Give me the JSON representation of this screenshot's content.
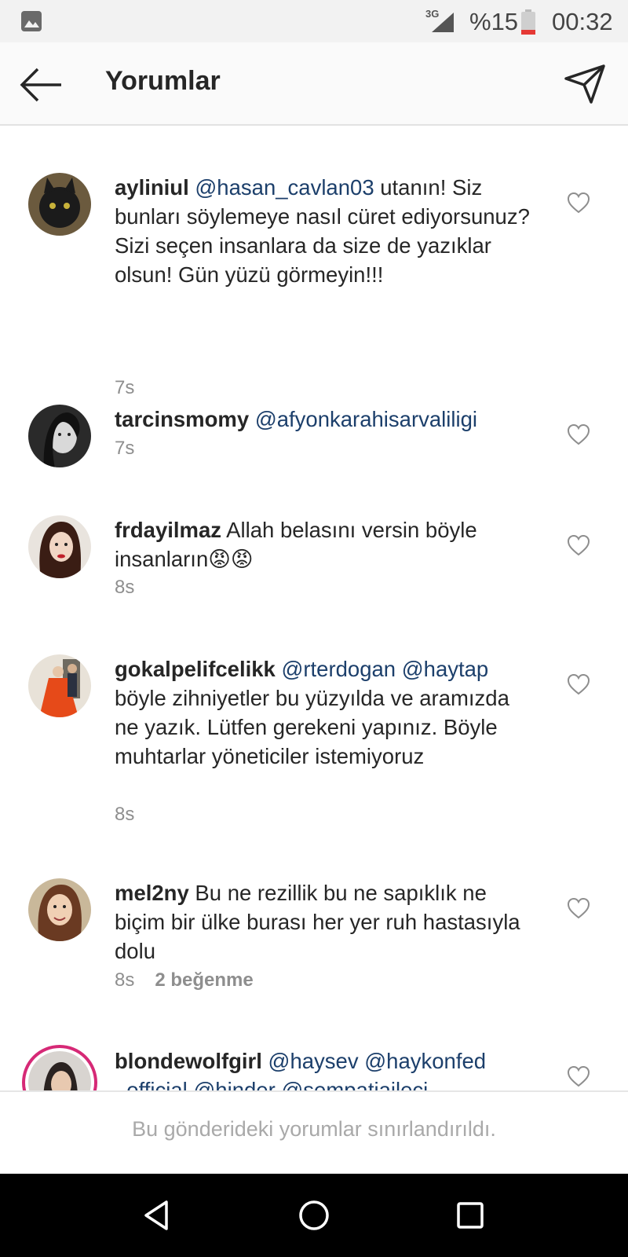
{
  "status_bar": {
    "network": "3G",
    "battery": "%15",
    "time": "00:32"
  },
  "header": {
    "title": "Yorumlar"
  },
  "comments": [
    {
      "username": "ayliniul",
      "mention": "@hasan_cavlan03",
      "text": " utanın! Siz bunları söylemeye nasıl cüret ediyorsunuz? Sizi seçen insanlara da size de yazıklar olsun! Gün yüzü görmeyin!!!",
      "time": "7s",
      "avatar": "black-cat"
    },
    {
      "username": "tarcinsmomy",
      "mention": "@afyonkarahisarvaliligi",
      "text": "",
      "time": "7s",
      "avatar": "woman-bw"
    },
    {
      "username": "frdayilmaz",
      "mention": "",
      "text": " Allah belasını versin böyle insanların😡😡",
      "time": "8s",
      "avatar": "woman-red-lips"
    },
    {
      "username": "gokalpelifcelikk",
      "mention": "@rterdogan @haytap",
      "text": " böyle zihniyetler bu yüzyılda ve aramızda ne yazık. Lütfen gerekeni yapınız. Böyle muhtarlar yöneticiler istemiyoruz",
      "time": "8s",
      "avatar": "couple-red-dress"
    },
    {
      "username": "mel2ny",
      "mention": "",
      "text": " Bu ne rezillik bu ne sapıklık ne biçim bir ülke burası her yer ruh hastasıyla dolu",
      "time": "8s",
      "likes": "2 beğenme",
      "avatar": "woman-smiling"
    },
    {
      "username": "blondewolfgirl",
      "mention": "@haysev @haykonfed _official @hinder @sempatiaileci",
      "text": "",
      "time": "",
      "avatar": "woman-story-ring"
    }
  ],
  "footer": {
    "notice": "Bu gönderideki yorumlar sınırlandırıldı."
  },
  "colors": {
    "mention": "#1c3f6b",
    "meta": "#8e8e8e",
    "story_ring": "#d62976"
  }
}
